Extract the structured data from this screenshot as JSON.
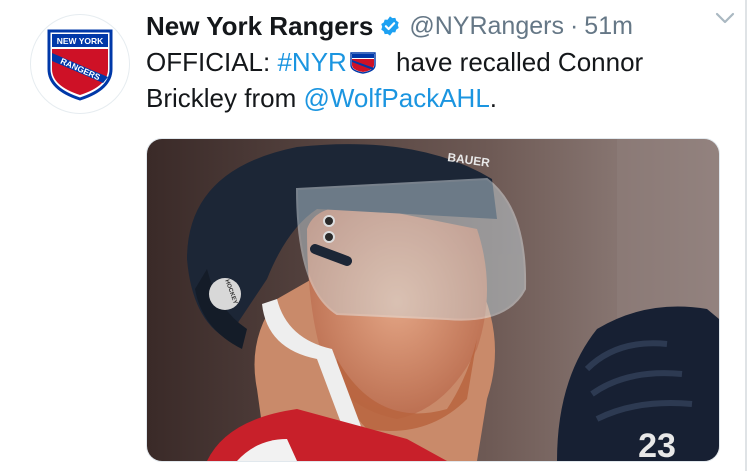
{
  "tweet": {
    "author_name": "New York Rangers",
    "handle": "@NYRangers",
    "separator": "·",
    "time": "51m",
    "text_prefix": "OFFICIAL: ",
    "hashtag": "#NYR",
    "text_middle": " have recalled Connor Brickley from ",
    "mention": "@WolfPackAHL",
    "text_suffix": "."
  },
  "avatar": {
    "line1": "NEW YORK",
    "line2": "RANGERS"
  },
  "photo": {
    "helmet_brand": "BAUER",
    "sticker_text": "HOCKEY",
    "jersey_number": "23"
  },
  "colors": {
    "link": "#1b95e0",
    "rangers_blue": "#0038a8",
    "rangers_red": "#ce1126",
    "verified": "#1da1f2"
  },
  "icons": [
    "verified-badge-icon",
    "chevron-down-icon",
    "rangers-hashflag-icon"
  ]
}
